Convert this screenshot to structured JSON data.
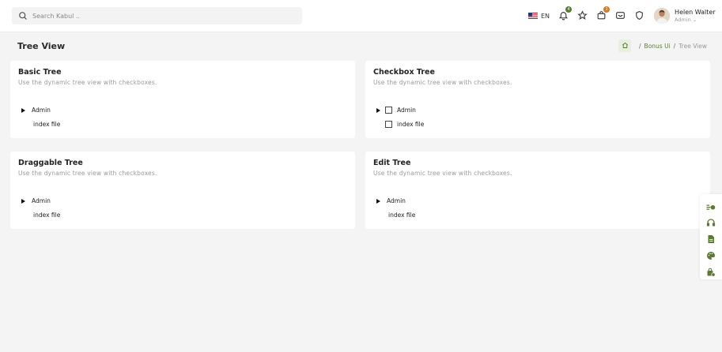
{
  "header": {
    "search_placeholder": "Search Kabul ..",
    "language": "EN",
    "notifications_count": "4",
    "cart_count": "1",
    "user_name": "Helen Walter",
    "user_role": "Admin ⌄"
  },
  "page": {
    "title": "Tree View",
    "breadcrumb": {
      "separator": "/",
      "section": "Bonus Ui",
      "current": "Tree View"
    }
  },
  "cards": {
    "basic": {
      "title": "Basic Tree",
      "subtitle": "Use the dynamic tree view with checkboxes.",
      "root": "Admin",
      "child": "index file"
    },
    "checkbox": {
      "title": "Checkbox Tree",
      "subtitle": "Use the dynamic tree view with checkboxes.",
      "root": "Admin",
      "child": "index file"
    },
    "draggable": {
      "title": "Draggable Tree",
      "subtitle": "Use the dynamic tree view with checkboxes.",
      "root": "Admin",
      "child": "index file"
    },
    "edit": {
      "title": "Edit Tree",
      "subtitle": "Use the dynamic tree view with checkboxes.",
      "root": "Admin",
      "child": "index file"
    }
  },
  "colors": {
    "accent": "#5b7a34",
    "badge_orange": "#d27a26",
    "background": "#f4f4f4"
  },
  "sidebar_icons": [
    "toggle-icon",
    "headset-icon",
    "document-icon",
    "palette-icon",
    "bag-icon"
  ]
}
